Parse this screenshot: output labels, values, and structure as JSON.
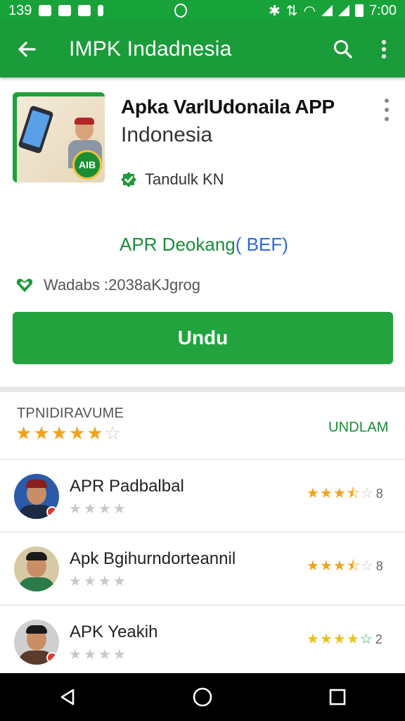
{
  "status_bar": {
    "left_text": "139",
    "time": "7:00"
  },
  "app_bar": {
    "title": "IMPK Indadnesia",
    "back_icon": "back-arrow-icon",
    "search_icon": "search-icon",
    "menu_icon": "overflow-menu-icon",
    "color": "#1a9c3a"
  },
  "app": {
    "name": "Apka VarlUdonaila APP",
    "developer": "Indonesia",
    "icon_badge_text": "AIB",
    "verified_label": "Tandulk KN",
    "apk_download_prefix": "APR Deokang",
    "apk_download_code": "( BEF)",
    "downloads_label": "Wadabs :2038aKJgrog",
    "install_label": "Undu",
    "accent": "#22a33e"
  },
  "rating": {
    "label": "TPNIDIRAVUME",
    "stars_filled": 5,
    "stars_total": 6,
    "action_label": "UNDLAM"
  },
  "reviews": [
    {
      "name": "APR Padbalbal",
      "rating": 3.5,
      "rating_text": "8"
    },
    {
      "name": "Apk Bgihurndorteannil",
      "rating": 3.5,
      "rating_text": "8"
    },
    {
      "name": "APK Yeakih",
      "rating": 4.5,
      "rating_text": "2"
    }
  ],
  "nav_bar": {
    "back_icon": "nav-back-icon",
    "home_icon": "nav-home-icon",
    "recents_icon": "nav-recents-icon"
  }
}
